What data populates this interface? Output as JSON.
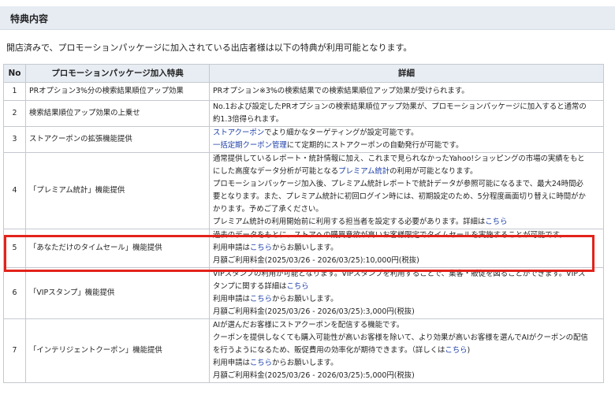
{
  "section": {
    "title": "特典内容"
  },
  "intro": "開店済みで、プロモーションパッケージに加入されている出店者様は以下の特典が利用可能となります。",
  "table": {
    "headers": {
      "no": "No",
      "benefit": "プロモーションパッケージ加入特典",
      "detail": "詳細"
    },
    "rows": [
      {
        "no": "1",
        "benefit": "PRオプション3%分の検索結果順位アップ効果",
        "lines": [
          [
            {
              "t": "PRオプション※3%の検索結果での検索結果順位アップ効果が受けられます。"
            }
          ]
        ]
      },
      {
        "no": "2",
        "benefit": "検索結果順位アップ効果の上乗せ",
        "lines": [
          [
            {
              "t": "No.1および設定したPRオプションの検索結果順位アップ効果が、プロモーションパッケージに加入すると通常の"
            }
          ],
          [
            {
              "t": "約1.3倍得られます。"
            }
          ]
        ]
      },
      {
        "no": "3",
        "benefit": "ストアクーポンの拡張機能提供",
        "lines": [
          [
            {
              "t": "ストアクーポン",
              "link": true
            },
            {
              "t": "でより細かなターゲティングが設定可能です。"
            }
          ],
          [
            {
              "t": "一括定期クーポン管理",
              "link": true
            },
            {
              "t": "にて定期的にストアクーポンの自動発行が可能です。"
            }
          ]
        ]
      },
      {
        "no": "4",
        "benefit": "「プレミアム統計」機能提供",
        "lines": [
          [
            {
              "t": "通常提供しているレポート・統計情報に加え、これまで見られなかったYahoo!ショッピングの市場の実績をもと"
            }
          ],
          [
            {
              "t": "にした高度なデータ分析が可能となる"
            },
            {
              "t": "プレミアム統計",
              "link": true
            },
            {
              "t": "の利用が可能となります。"
            }
          ],
          [
            {
              "t": "プロモーションパッケージ加入後、プレミアム統計レポートで統計データが参照可能になるまで、最大24時間必"
            }
          ],
          [
            {
              "t": "要となります。また、プレミアム統計に初回ログイン時には、初期設定のため、5分程度画面切り替えに時間がか"
            }
          ],
          [
            {
              "t": "かります。予めご了承ください。"
            }
          ],
          [
            {
              "t": "プレミアム統計の利用開始前に利用する担当者を設定する必要があります。詳細は"
            },
            {
              "t": "こちら",
              "link": true
            }
          ]
        ]
      },
      {
        "no": "5",
        "benefit": "「あなただけのタイムセール」機能提供",
        "lines": [
          [
            {
              "t": "過去のデータをもとに、ストアへの購買意欲が高いお客様限定でタイムセールを実施することが可能です。"
            }
          ],
          [
            {
              "t": "利用申請は"
            },
            {
              "t": "こちら",
              "link": true
            },
            {
              "t": "からお願いします。"
            }
          ],
          [
            {
              "t": "月額ご利用料金(2025/03/26 - 2026/03/25):10,000円(税抜)"
            }
          ]
        ]
      },
      {
        "no": "6",
        "benefit": "「VIPスタンプ」機能提供",
        "lines": [
          [
            {
              "t": "VIPスタンプの利用が可能となります。VIPスタンプを利用することで、集客・販促を図ることができます。VIPス"
            }
          ],
          [
            {
              "t": "タンプに関する詳細は"
            },
            {
              "t": "こちら",
              "link": true
            }
          ],
          [
            {
              "t": "利用申請は"
            },
            {
              "t": "こちら",
              "link": true
            },
            {
              "t": "からお願いします。"
            }
          ],
          [
            {
              "t": "月額ご利用料金(2025/03/26 - 2026/03/25):3,000円(税抜)"
            }
          ]
        ]
      },
      {
        "no": "7",
        "benefit": "「インテリジェントクーポン」機能提供",
        "lines": [
          [
            {
              "t": "AIが選んだお客様にストアクーポンを配信する機能です。"
            }
          ],
          [
            {
              "t": "クーポンを提供しなくても購入可能性が高いお客様を除いて、より効果が高いお客様を選んでAIがクーポンの配信"
            }
          ],
          [
            {
              "t": "を行うようになるため、販促費用の効率化が期待できます。（詳しくは"
            },
            {
              "t": "こちら",
              "link": true
            },
            {
              "t": ")"
            }
          ],
          [
            {
              "t": "利用申請は"
            },
            {
              "t": "こちら",
              "link": true
            },
            {
              "t": "からお願いします。"
            }
          ],
          [
            {
              "t": "月額ご利用料金(2025/03/26 - 2026/03/25):5,000円(税抜)"
            }
          ]
        ]
      }
    ]
  },
  "colors": {
    "header_bg": "#e7ecf3",
    "link": "#1a3da8",
    "highlight": "#e2231a"
  }
}
